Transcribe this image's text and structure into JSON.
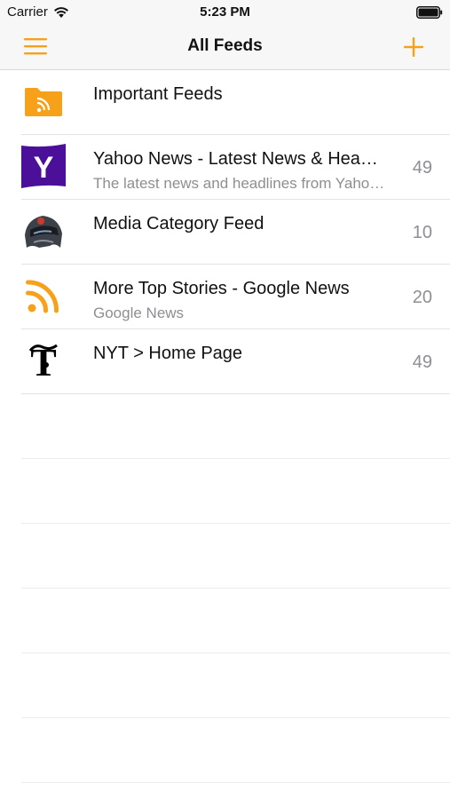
{
  "status_bar": {
    "carrier": "Carrier",
    "time": "5:23 PM"
  },
  "nav": {
    "title": "All Feeds",
    "menu_icon": "hamburger-menu-icon",
    "add_icon": "plus-icon",
    "accent_color": "#f7a11a"
  },
  "feeds": [
    {
      "title": "Important Feeds",
      "subtitle": "",
      "count": "",
      "icon": "folder-rss-icon"
    },
    {
      "title": "Yahoo News - Latest News & Headlines",
      "subtitle": "The latest news and headlines from Yahoo! News",
      "count": "49",
      "icon": "yahoo-logo-icon"
    },
    {
      "title": "Media Category Feed",
      "subtitle": "",
      "count": "10",
      "icon": "media-helmet-icon"
    },
    {
      "title": "More Top Stories - Google News",
      "subtitle": "Google News",
      "count": "20",
      "icon": "rss-icon"
    },
    {
      "title": "NYT > Home Page",
      "subtitle": "",
      "count": "49",
      "icon": "nyt-logo-icon"
    }
  ]
}
